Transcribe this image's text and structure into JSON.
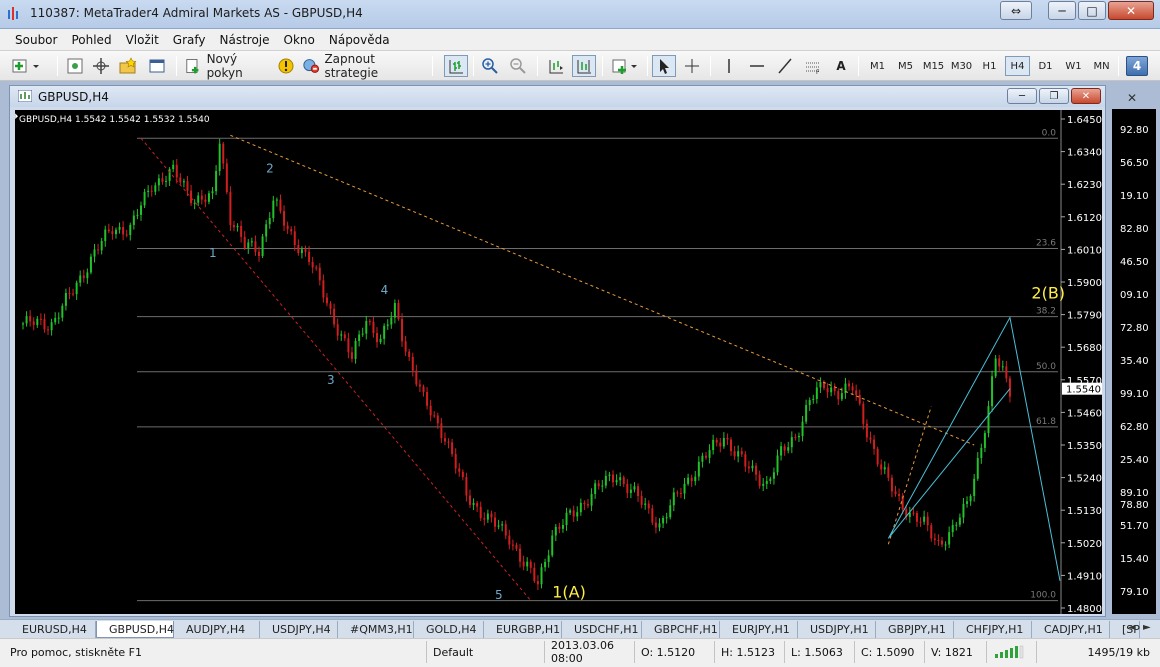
{
  "window": {
    "title": "110387: MetaTrader4 Admiral Markets AS - GBPUSD,H4"
  },
  "menu": [
    "Soubor",
    "Pohled",
    "Vložit",
    "Grafy",
    "Nástroje",
    "Okno",
    "Nápověda"
  ],
  "toolbar": {
    "new_order": "Nový pokyn",
    "autotrading": "Zapnout strategie",
    "text_tool": "A",
    "timeframes": [
      "M1",
      "M5",
      "M15",
      "M30",
      "H1",
      "H4",
      "D1",
      "W1",
      "MN"
    ],
    "active_timeframe": "H4",
    "badge": "4"
  },
  "chart_window": {
    "title": "GBPUSD,H4"
  },
  "chart_data": {
    "type": "candlestick",
    "symbol": "GBPUSD",
    "timeframe": "H4",
    "header": "GBPUSD,H4  1.5542 1.5542 1.5532 1.5540",
    "current_price": "1.5540",
    "y_ticks": [
      "1.6450",
      "1.6340",
      "1.6230",
      "1.6120",
      "1.6010",
      "1.5900",
      "1.5790",
      "1.5680",
      "1.5570",
      "1.5460",
      "1.5350",
      "1.5240",
      "1.5130",
      "1.5020",
      "1.4910",
      "1.4800"
    ],
    "y_range": [
      1.48,
      1.645
    ],
    "fib_levels": [
      {
        "label": "0.0",
        "price": 1.6385
      },
      {
        "label": "23.6",
        "price": 1.6013
      },
      {
        "label": "38.2",
        "price": 1.5783
      },
      {
        "label": "50.0",
        "price": 1.5597
      },
      {
        "label": "61.8",
        "price": 1.5411
      },
      {
        "label": "100.0",
        "price": 1.4825
      }
    ],
    "wave_labels": [
      {
        "text": "1",
        "color": "#6fa8c8",
        "x": 52,
        "y": 1.5985
      },
      {
        "text": "2",
        "color": "#6fa8c8",
        "x": 68,
        "y": 1.627
      },
      {
        "text": "3",
        "color": "#6fa8c8",
        "x": 85,
        "y": 1.5555
      },
      {
        "text": "4",
        "color": "#6fa8c8",
        "x": 100,
        "y": 1.586
      },
      {
        "text": "5",
        "color": "#6fa8c8",
        "x": 132,
        "y": 1.483
      },
      {
        "text": "1(A)",
        "color": "#ffee44",
        "x": 148,
        "y": 1.4835
      },
      {
        "text": "2(B)",
        "color": "#ffee44",
        "x": 282,
        "y": 1.5845
      }
    ],
    "projection": [
      [
        242,
        1.5035
      ],
      [
        276,
        1.578
      ],
      [
        290,
        1.4892
      ]
    ],
    "channel_lines": [
      {
        "from": [
          33,
          1.6385
        ],
        "to": [
          142,
          1.4825
        ],
        "color": "#cc2222"
      },
      {
        "from": [
          58,
          1.6395
        ],
        "to": [
          266,
          1.535
        ],
        "color": "#e89b3a"
      },
      {
        "from": [
          242,
          1.5015
        ],
        "to": [
          254,
          1.548
        ],
        "color": "#e89b3a"
      }
    ],
    "bar_count": 290
  },
  "right_strip": [
    "92.80",
    "56.50",
    "19.10",
    "82.80",
    "46.50",
    "09.10",
    "72.80",
    "35.40",
    "99.10",
    "62.80",
    "25.40",
    "89.10",
    "78.80",
    "51.70",
    "15.40",
    "79.10"
  ],
  "tabs": [
    "EURUSD,H4",
    "GBPUSD,H4",
    "AUDJPY,H4",
    "USDJPY,H4",
    "#QMM3,H1",
    "GOLD,H4",
    "EURGBP,H1",
    "USDCHF,H1",
    "GBPCHF,H1",
    "EURJPY,H1",
    "USDJPY,H1",
    "GBPJPY,H1",
    "CHFJPY,H1",
    "CADJPY,H1",
    "[SP"
  ],
  "active_tab": "GBPUSD,H4",
  "status": {
    "help": "Pro pomoc, stiskněte F1",
    "profile": "Default",
    "datetime": "2013.03.06 08:00",
    "open": "O: 1.5120",
    "high": "H: 1.5123",
    "low": "L: 1.5063",
    "close": "C: 1.5090",
    "volume": "V: 1821",
    "traffic": "1495/19 kb"
  },
  "colors": {
    "bull": "#22c22a",
    "bear": "#d11f1f",
    "grid": "#6d6d6d",
    "axis_text": "#ffffff"
  }
}
